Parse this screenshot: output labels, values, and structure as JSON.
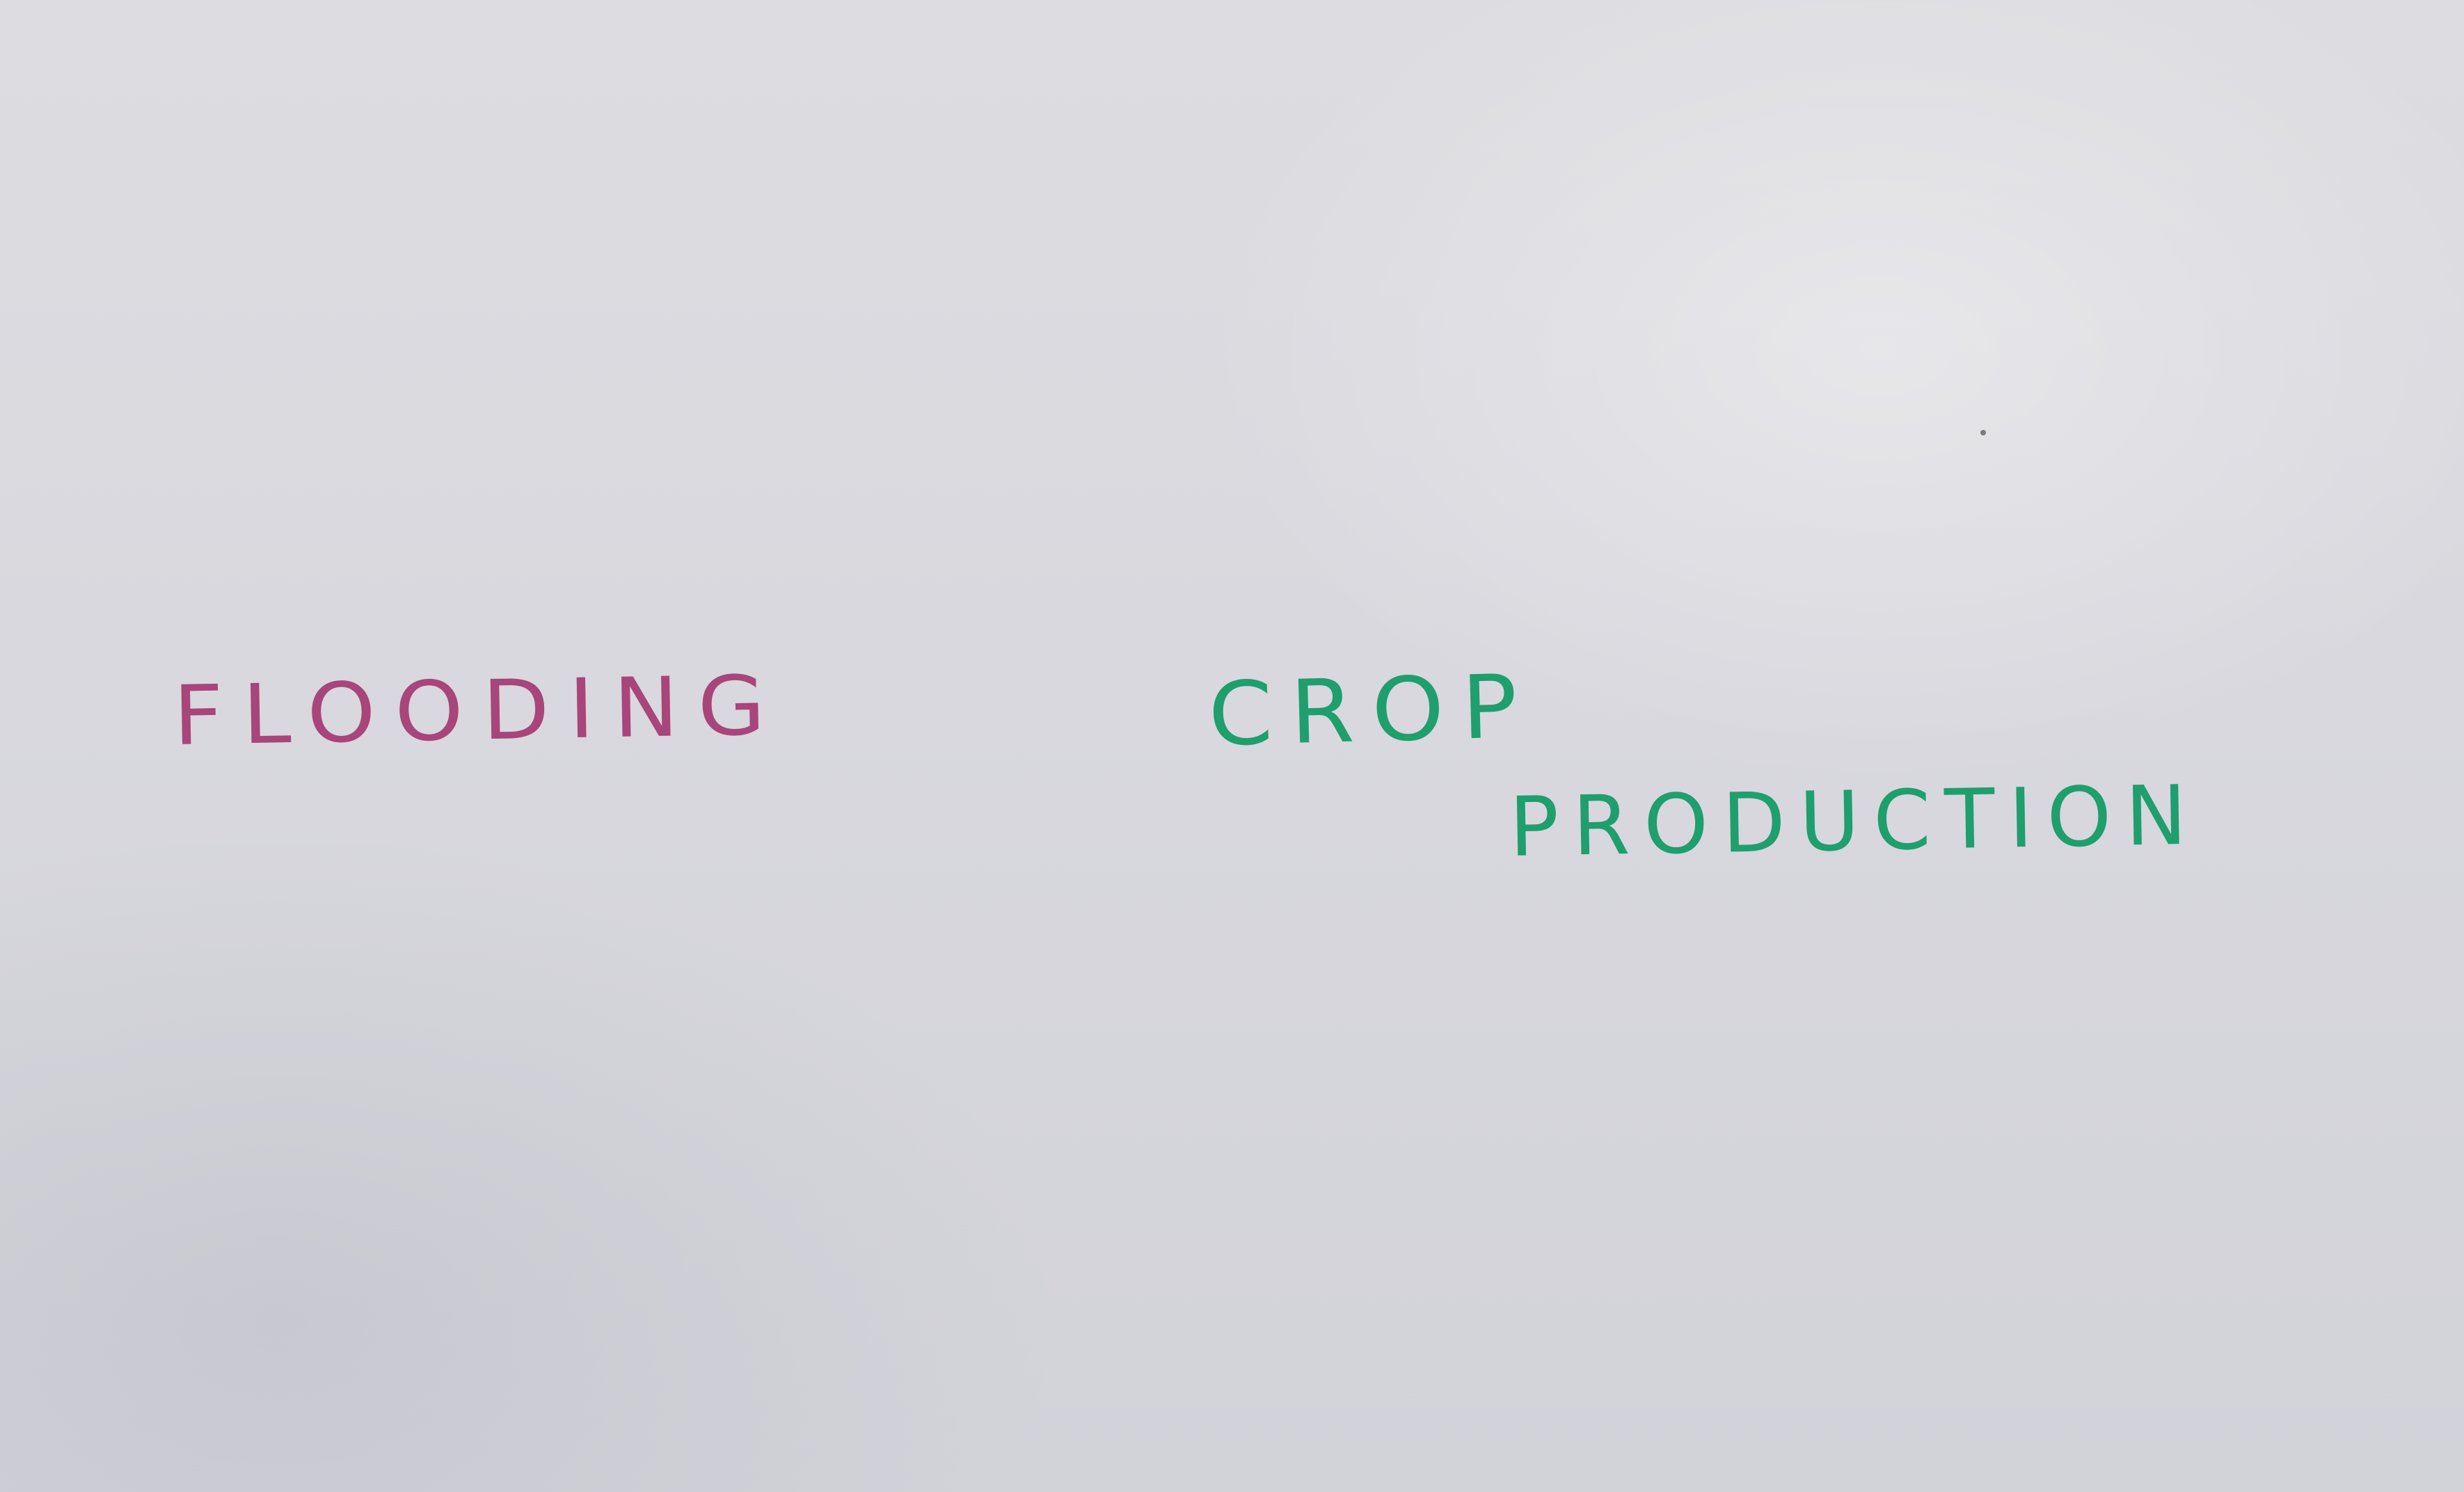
{
  "words": {
    "flooding": "FLOODING",
    "crop": "CROP",
    "production": "PRODUCTION"
  },
  "colors": {
    "flooding": "#a8457a",
    "crop_production": "#1f9e6e",
    "paper": "#d9d9de"
  }
}
